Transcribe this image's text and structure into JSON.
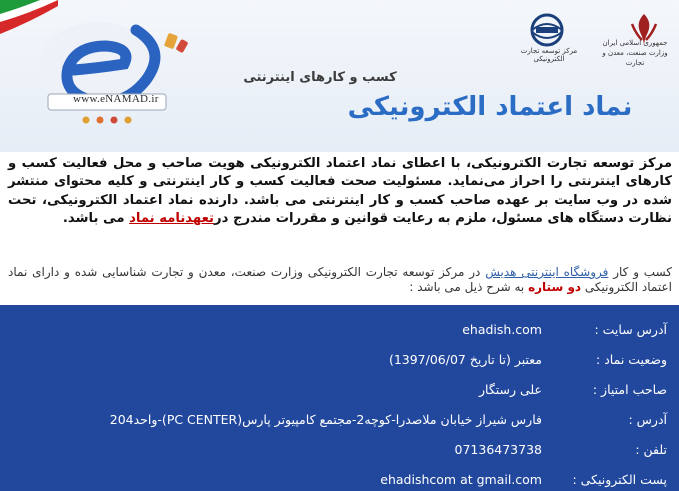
{
  "header": {
    "site_url": "www.eNAMAD.ir",
    "tagline": "کسب و کارهای اینترنتی",
    "main_title": "نماد اعتماد الکترونیکی",
    "emblem_center_text": "مرکز توسعه تجارت الکترونیکی",
    "emblem_right_text_line1": "جمهوری اسلامی ایران",
    "emblem_right_text_line2": "وزارت صنعت، معدن و تجارت"
  },
  "description": {
    "part1": "مرکز توسعه تجارت الکترونیکی، با اعطای نماد اعتماد الکترونیکی هویت صاحب و محل فعالیت کسب و کارهای اینترنتی را احراز می‌نماید. مسئولیت صحت فعالیت کسب و کار اینترنتی و کلیه محتوای منتشر شده در وب سایت بر عهده صاحب کسب و کار اینترنتی می باشد. دارنده نماد اعتماد الکترونیکی، تحت نظارت دستگاه های مسئول، ملزم به رعایت قوانین و مقررات مندرج در",
    "link_text": "تعهدنامه نماد",
    "part2": " می باشد."
  },
  "subtext": {
    "part1": "کسب و کار ",
    "store_link": "فروشگاه اینترنتی هدیش",
    "part2": " در مرکز توسعه تجارت الکترونیکی وزارت صنعت، معدن و تجارت شناسایی شده و دارای نماد اعتماد الکترونیکی ",
    "stars": "دو ستاره",
    "part3": " به شرح ذیل می باشد :"
  },
  "info": {
    "rows": [
      {
        "label": "آدرس سایت :",
        "value": "ehadish.com"
      },
      {
        "label": "وضعیت نماد :",
        "value": "معتبر (تا تاریخ 1397/06/07)"
      },
      {
        "label": "صاحب امتیاز :",
        "value": "علی رستگار"
      },
      {
        "label": "آدرس :",
        "value": "فارس شیراز خیابان ملاصدرا-کوچه2-مجتمع کامپیوتر پارس(PC CENTER)-واحد204"
      },
      {
        "label": "تلفن :",
        "value": "07136473738"
      },
      {
        "label": "پست الکترونیکی :",
        "value": "ehadishcom at gmail.com"
      }
    ]
  },
  "colors": {
    "panel_bg": "#22489e",
    "title_blue": "#2b6cc4",
    "link_red": "#c00000",
    "link_blue": "#2f5fa8"
  },
  "icons": [
    "iran-flag-icon",
    "enamad-e-logo-icon",
    "ecommerce-center-emblem-icon",
    "ministry-emblem-icon"
  ]
}
